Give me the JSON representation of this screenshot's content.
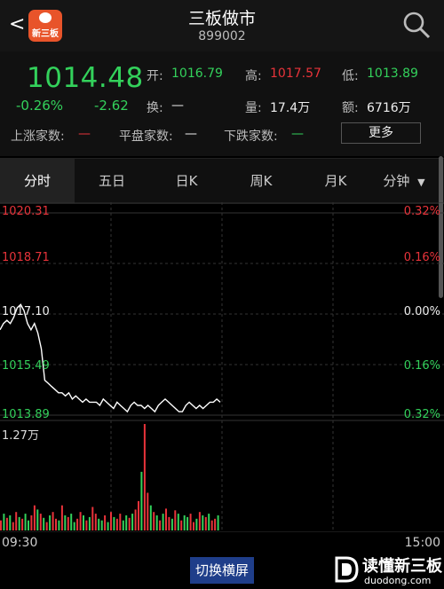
{
  "header": {
    "back_glyph": "<",
    "logo_text": "新三板",
    "title": "三板做市",
    "code": "899002"
  },
  "quote": {
    "price": "1014.48",
    "change_pct": "-0.26%",
    "change_abs": "-2.62",
    "open_label": "开:",
    "open_value": "1016.79",
    "high_label": "高:",
    "high_value": "1017.57",
    "low_label": "低:",
    "low_value": "1013.89",
    "turnover_label": "换:",
    "turnover_value": "—",
    "volume_label": "量:",
    "volume_value": "17.4万",
    "amount_label": "额:",
    "amount_value": "6716万",
    "up_label": "上涨家数:",
    "up_value": "—",
    "flat_label": "平盘家数:",
    "flat_value": "—",
    "down_label": "下跌家数:",
    "down_value": "—",
    "more_label": "更多"
  },
  "tabs": [
    {
      "label": "分时"
    },
    {
      "label": "五日"
    },
    {
      "label": "日K"
    },
    {
      "label": "周K"
    },
    {
      "label": "月K"
    },
    {
      "label": "分钟"
    }
  ],
  "chart": {
    "y_left": [
      "1020.31",
      "1018.71",
      "1017.10",
      "1015.49",
      "1013.89"
    ],
    "y_right": [
      "0.32%",
      "0.16%",
      "0.00%",
      "0.16%",
      "0.32%"
    ],
    "vol_max": "1.27万",
    "time_start": "09:30",
    "time_end": "15:00"
  },
  "chart_data": {
    "type": "line",
    "x_range": [
      "09:30",
      "15:00"
    ],
    "ylim": [
      1013.89,
      1020.31
    ],
    "prev_close": 1017.1,
    "price": [
      1016.6,
      1016.8,
      1016.9,
      1016.8,
      1017.0,
      1017.3,
      1017.4,
      1017.2,
      1016.8,
      1016.6,
      1016.8,
      1016.5,
      1016.0,
      1015.0,
      1014.9,
      1014.8,
      1014.7,
      1014.6,
      1014.6,
      1014.5,
      1014.6,
      1014.4,
      1014.5,
      1014.4,
      1014.3,
      1014.4,
      1014.3,
      1014.3,
      1014.3,
      1014.2,
      1014.4,
      1014.3,
      1014.2,
      1014.1,
      1014.3,
      1014.2,
      1014.1,
      1014.0,
      1014.2,
      1014.3,
      1014.2,
      1014.2,
      1014.1,
      1014.2,
      1014.1,
      1014.0,
      1014.2,
      1014.3,
      1014.4,
      1014.3,
      1014.2,
      1014.1,
      1014.0,
      1014.0,
      1014.2,
      1014.3,
      1014.2,
      1014.1,
      1014.2,
      1014.1,
      1014.2,
      1014.3,
      1014.3,
      1014.4,
      1014.3
    ],
    "volume_max_wan": 1.27,
    "volume": [
      0.12,
      0.2,
      0.15,
      0.18,
      0.1,
      0.22,
      0.16,
      0.14,
      0.2,
      0.12,
      0.18,
      0.3,
      0.25,
      0.2,
      0.15,
      0.1,
      0.18,
      0.22,
      0.14,
      0.12,
      0.3,
      0.18,
      0.16,
      0.2,
      0.1,
      0.14,
      0.22,
      0.18,
      0.12,
      0.16,
      0.28,
      0.2,
      0.14,
      0.12,
      0.18,
      0.1,
      0.22,
      0.16,
      0.14,
      0.2,
      0.12,
      0.18,
      0.15,
      0.2,
      0.25,
      0.35,
      0.7,
      1.27,
      0.45,
      0.3,
      0.22,
      0.18,
      0.12,
      0.2,
      0.26,
      0.16,
      0.14,
      0.24,
      0.2,
      0.12,
      0.18,
      0.16,
      0.2,
      0.1,
      0.14,
      0.22,
      0.18,
      0.16,
      0.2,
      0.12,
      0.14,
      0.18
    ],
    "volume_up": [
      1,
      0,
      1,
      0,
      1,
      1,
      0,
      1,
      0,
      0,
      1,
      1,
      0,
      1,
      0,
      1,
      0,
      1,
      1,
      0,
      1,
      0,
      1,
      0,
      0,
      1,
      1,
      0,
      1,
      0,
      1,
      1,
      0,
      0,
      1,
      0,
      1,
      0,
      1,
      1,
      0,
      0,
      1,
      0,
      1,
      1,
      0,
      1,
      1,
      0,
      1,
      0,
      1,
      0,
      1,
      1,
      0,
      1,
      0,
      1,
      0,
      0,
      1,
      1,
      0,
      1,
      0,
      1,
      0,
      1,
      1,
      0
    ]
  },
  "footer": {
    "switch_label": "切换横屏",
    "watermark_title": "读懂新三板",
    "watermark_sub": "duodong.com"
  },
  "colors": {
    "up": "#e8333a",
    "down": "#33d15b",
    "line": "#ffffff",
    "grid": "#333333"
  }
}
